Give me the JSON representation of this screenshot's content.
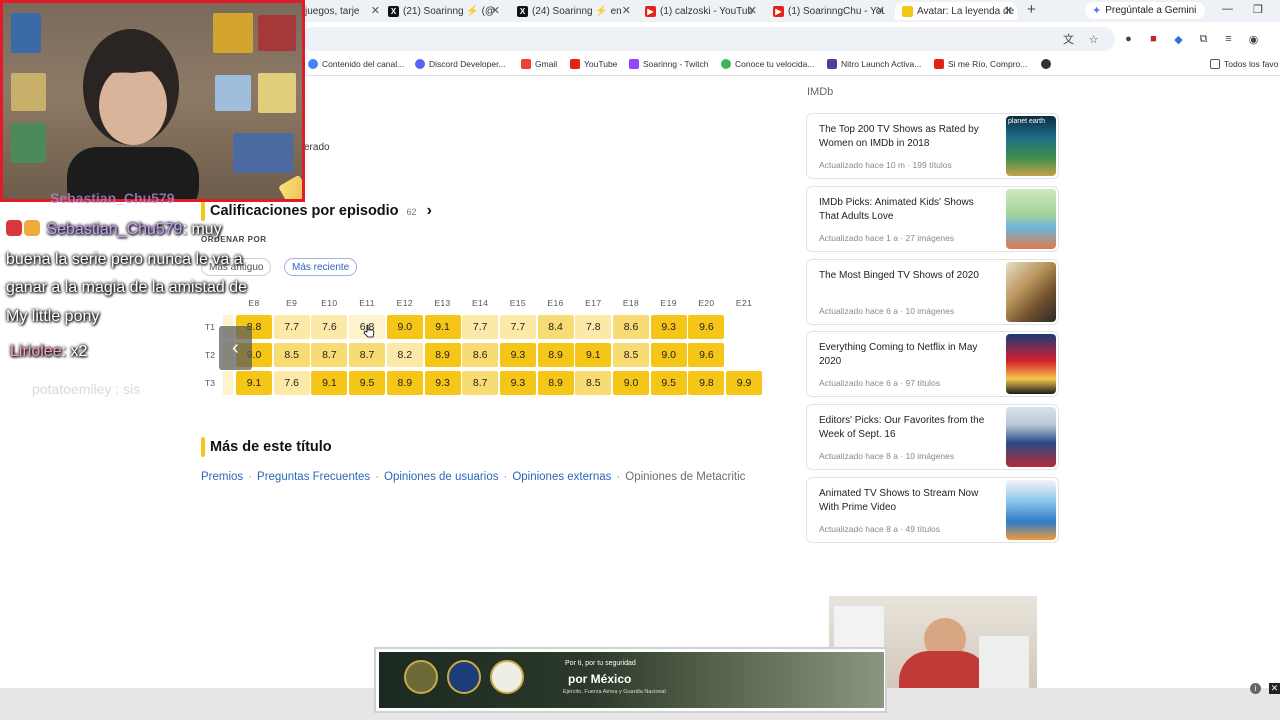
{
  "browser": {
    "tabs": [
      {
        "label": "juegos, tarje"
      },
      {
        "label": "(21) Soarinng ⚡ (@"
      },
      {
        "label": "(24) Soarinng ⚡ en"
      },
      {
        "label": "(1) calzoski - YouTub"
      },
      {
        "label": "(1) SoarinngChu - You"
      },
      {
        "label": "Avatar: La leyenda de"
      }
    ],
    "new_tab": "+",
    "gemini": "Pregúntale a Gemini",
    "bookmarks": [
      "Contenido del canal...",
      "Discord Developer...",
      "Gmail",
      "YouTube",
      "Soarinng - Twitch",
      "Conoce tu velocida...",
      "Nitro Launch Activa...",
      "Si me Río, Compro..."
    ],
    "all_bookmarks": "Todos los favo"
  },
  "page": {
    "rated_fragment": "erado",
    "ratings_title": "Calificaciones por episodio",
    "ratings_count": "62",
    "order_label": "ORDENAR POR",
    "sort_oldest": "Más antiguo",
    "sort_recent": "Más reciente",
    "episode_headers": [
      "E8",
      "E9",
      "E10",
      "E11",
      "E12",
      "E13",
      "E14",
      "E15",
      "E16",
      "E17",
      "E18",
      "E19",
      "E20",
      "E21"
    ],
    "seasons": [
      {
        "label": "T1",
        "ratings": [
          "8.8",
          "7.7",
          "7.6",
          "6.8",
          "9.0",
          "9.1",
          "7.7",
          "7.7",
          "8.4",
          "7.8",
          "8.6",
          "9.3",
          "9.6"
        ]
      },
      {
        "label": "T2",
        "ratings": [
          "9.0",
          "8.5",
          "8.7",
          "8.7",
          "8.2",
          "8.9",
          "8.6",
          "9.3",
          "8.9",
          "9.1",
          "8.5",
          "9.0",
          "9.6"
        ]
      },
      {
        "label": "T3",
        "ratings": [
          "9.1",
          "7.6",
          "9.1",
          "9.5",
          "8.9",
          "9.3",
          "8.7",
          "9.3",
          "8.9",
          "8.5",
          "9.0",
          "9.5",
          "9.8",
          "9.9"
        ]
      }
    ],
    "more_title": "Más de este título",
    "more_links": [
      "Premios",
      "Preguntas Frecuentes",
      "Opiniones de usuarios",
      "Opiniones externas",
      "Opiniones de Metacritic"
    ]
  },
  "sidebar": {
    "label": "IMDb",
    "lists": [
      {
        "title": "The Top 200 TV Shows as Rated by Women on IMDb in 2018",
        "meta": "Actualizado hace 10 m · 199 títulos",
        "thumb_text": "planet earth"
      },
      {
        "title": "IMDb Picks: Animated Kids' Shows That Adults Love",
        "meta": "Actualizado hace 1 a · 27 imágenes",
        "thumb_text": ""
      },
      {
        "title": "The Most Binged TV Shows of 2020",
        "meta": "Actualizado hace 6 a · 10 imágenes",
        "thumb_text": ""
      },
      {
        "title": "Everything Coming to Netflix in May 2020",
        "meta": "Actualizado hace 6 a · 97 títulos",
        "thumb_text": ""
      },
      {
        "title": "Editors' Picks: Our Favorites from the Week of Sept. 16",
        "meta": "Actualizado hace 8 a · 10 imágenes",
        "thumb_text": ""
      },
      {
        "title": "Animated TV Shows to Stream Now With Prime Video",
        "meta": "Actualizado hace 8 a · 49 títulos",
        "thumb_text": ""
      }
    ]
  },
  "ad": {
    "line1": "Por ti, por tu seguridad",
    "line2": "por México",
    "line3": "Ejército, Fuerza Aérea y Guardia Nacional"
  },
  "stream": {
    "prev_user": "Sebastian_Chu579",
    "messages": [
      {
        "user": "Sebastian_Chu579",
        "text": ": muy"
      },
      {
        "user": "",
        "text": "buena la serie pero nunca le va a"
      },
      {
        "user": "",
        "text": "ganar a la magia de la amistad de"
      },
      {
        "user": "",
        "text": "My little pony"
      },
      {
        "user": "Liriolee",
        "text": ": x2"
      }
    ],
    "fading": "potatoemiley : sis"
  },
  "colors": {
    "imdb_yellow": "#f5c518",
    "link_blue": "#2a66b8",
    "webcam_border": "#e21b2b"
  }
}
